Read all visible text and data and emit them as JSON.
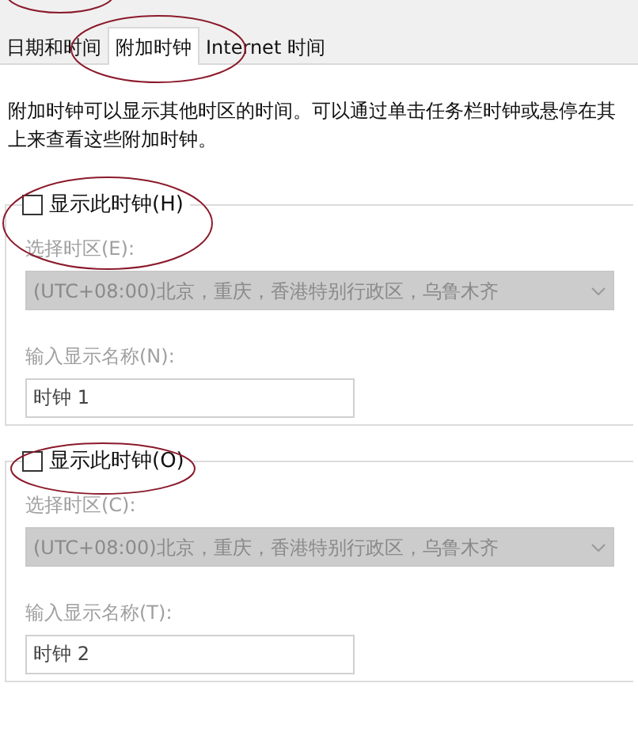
{
  "tabs": [
    {
      "label": "日期和时间",
      "selected": false
    },
    {
      "label": "附加时钟",
      "selected": true
    },
    {
      "label": "Internet 时间",
      "selected": false
    }
  ],
  "description": "附加时钟可以显示其他时区的时间。可以通过单击任务栏时钟或悬停在其上来查看这些附加时钟。",
  "clocks": [
    {
      "checkbox_label": "显示此时钟(H)",
      "checked": false,
      "timezone_label": "选择时区(E):",
      "timezone_value": "(UTC+08:00)北京，重庆，香港特别行政区，乌鲁木齐",
      "name_label": "输入显示名称(N):",
      "name_value": "时钟 1",
      "disabled": true
    },
    {
      "checkbox_label": "显示此时钟(O)",
      "checked": false,
      "timezone_label": "选择时区(C):",
      "timezone_value": "(UTC+08:00)北京，重庆，香港特别行政区，乌鲁木齐",
      "name_label": "输入显示名称(T):",
      "name_value": "时钟 2",
      "disabled": true
    }
  ]
}
